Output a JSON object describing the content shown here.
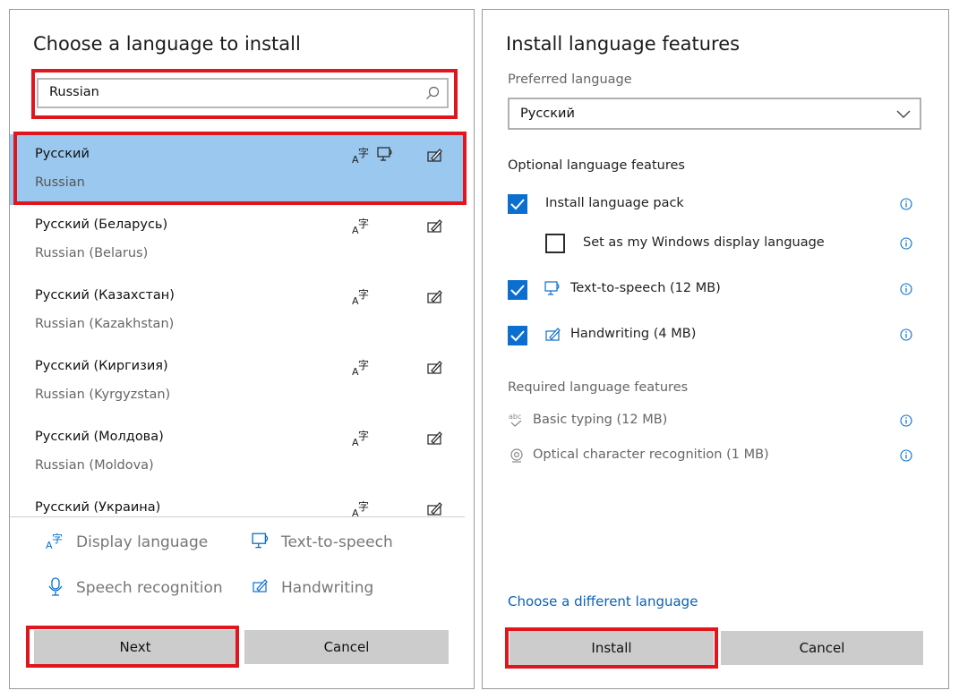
{
  "left_panel": {
    "title": "Choose a language to install",
    "search": {
      "value": "Russian"
    },
    "languages": [
      {
        "name": "Русский",
        "english": "Russian",
        "selected": true,
        "has_tts": true
      },
      {
        "name": "Русский (Беларусь)",
        "english": "Russian (Belarus)",
        "selected": false,
        "has_tts": false
      },
      {
        "name": "Русский (Казахстан)",
        "english": "Russian (Kazakhstan)",
        "selected": false,
        "has_tts": false
      },
      {
        "name": "Русский (Киргизия)",
        "english": "Russian (Kyrgyzstan)",
        "selected": false,
        "has_tts": false
      },
      {
        "name": "Русский (Молдова)",
        "english": "Russian (Moldova)",
        "selected": false,
        "has_tts": false
      },
      {
        "name": "Русский (Украина)",
        "english": "",
        "selected": false,
        "has_tts": false
      }
    ],
    "legend": {
      "display_language": "Display language",
      "text_to_speech": "Text-to-speech",
      "speech_recognition": "Speech recognition",
      "handwriting": "Handwriting"
    },
    "buttons": {
      "next": "Next",
      "cancel": "Cancel"
    }
  },
  "right_panel": {
    "title": "Install language features",
    "preferred_label": "Preferred language",
    "preferred_value": "Русский",
    "optional_header": "Optional language features",
    "optional": {
      "language_pack": {
        "label": "Install language pack",
        "checked": true
      },
      "display_language": {
        "label": "Set as my Windows display language",
        "checked": false
      },
      "tts": {
        "label": "Text-to-speech (12 MB)",
        "checked": true
      },
      "handwriting": {
        "label": "Handwriting (4 MB)",
        "checked": true
      }
    },
    "required_header": "Required language features",
    "required": {
      "basic_typing": "Basic typing (12 MB)",
      "ocr": "Optical character recognition (1 MB)"
    },
    "choose_link": "Choose a different language",
    "buttons": {
      "install": "Install",
      "cancel": "Cancel"
    }
  },
  "colors": {
    "accent": "#0a6fd0",
    "selection": "#9ac8ee",
    "highlight_box": "#e0161f",
    "button_bg": "#cccccc"
  }
}
